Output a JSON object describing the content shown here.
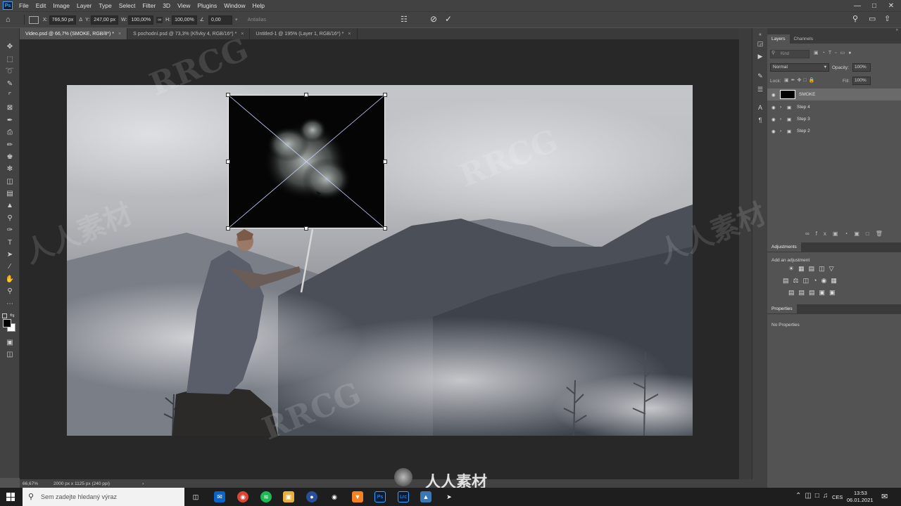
{
  "menubar": {
    "logo": "Ps",
    "items": [
      "File",
      "Edit",
      "Image",
      "Layer",
      "Type",
      "Select",
      "Filter",
      "3D",
      "View",
      "Plugins",
      "Window",
      "Help"
    ]
  },
  "options": {
    "x_label": "X:",
    "x_value": "766,50 px",
    "y_label": "Y:",
    "y_value": "247,00 px",
    "w_label": "W:",
    "w_value": "100,00%",
    "h_label": "H:",
    "h_value": "100,00%",
    "angle_value": "0,00",
    "antialias_label": "Antialias"
  },
  "tabs": [
    {
      "label": "Video.psd @ 66,7% (SMOKE, RGB/8*) *"
    },
    {
      "label": "S pochodní.psd @ 73,3% (Křivky 4, RGB/16*) *"
    },
    {
      "label": "Untitled-1 @ 195% (Layer 1, RGB/16*) *"
    }
  ],
  "status": {
    "zoom": "66,67%",
    "doc_size": "2000 px x 1125 px (240 ppi)"
  },
  "layers_panel": {
    "tab_layers": "Layers",
    "tab_channels": "Channels",
    "search_placeholder": "Kind",
    "blend_mode": "Normal",
    "opacity_label": "Opacity:",
    "opacity_value": "100%",
    "lock_label": "Lock:",
    "fill_label": "Fill:",
    "fill_value": "100%",
    "layers": [
      {
        "name": "SMOKE"
      },
      {
        "name": "Step 4"
      },
      {
        "name": "Step 3"
      },
      {
        "name": "Step 2"
      }
    ]
  },
  "adjustments_panel": {
    "title": "Adjustments",
    "subtitle": "Add an adjustment"
  },
  "properties_panel": {
    "title": "Properties",
    "content": "No Properties"
  },
  "taskbar": {
    "search_placeholder": "Sem zadejte hledaný výraz",
    "lang": "CES",
    "time": "13:53",
    "date": "06.01.2021"
  },
  "watermarks": {
    "brand": "RRCG",
    "cn": "人人素材"
  },
  "colors": {
    "accent": "#31a8ff",
    "selection": "#ffffff"
  }
}
